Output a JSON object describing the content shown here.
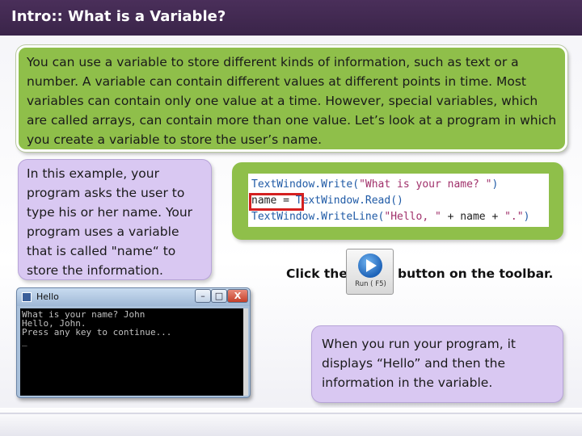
{
  "slide": {
    "title": "Intro:: What is a Variable?",
    "intro_text": "You can use a variable to store different kinds of information, such as text or a number. A variable can contain different values at different points in time. Most variables can contain only one value at a time. However, special variables, which are called arrays, can contain more than one value. Let’s look at a program in which you create a variable to store the user’s name.",
    "example_text": "In this example, your program asks the user to type his or her name. Your program uses a variable that is called \"name“ to store the information.",
    "click_prefix": "Click the",
    "click_suffix": "button on the toolbar.",
    "result_text": "When you run your program, it displays “Hello” and then the information in the variable."
  },
  "code": {
    "line1": {
      "obj": "TextWindow",
      "method": ".Write(",
      "str": "\"What is your name? \"",
      "end": ")"
    },
    "line2": {
      "var": "name",
      "op": " = ",
      "obj": "TextWindow",
      "method": ".Read()"
    },
    "line3": {
      "obj": "TextWindow",
      "method": ".WriteLine(",
      "str1": "\"Hello, \"",
      "mid": " + name + ",
      "str2": "\".\"",
      "end": ")"
    }
  },
  "toolbar_button": {
    "label": "Run ( F5)",
    "icon": "play-icon"
  },
  "console": {
    "title": "Hello",
    "lines": [
      "What is your name? John",
      "Hello, John.",
      "Press any key to continue...",
      "_"
    ]
  },
  "colors": {
    "title_bar": "#3a2449",
    "green_box": "#8fbf4a",
    "lavender_box": "#d9c8f2",
    "highlight_box": "#d42020"
  }
}
